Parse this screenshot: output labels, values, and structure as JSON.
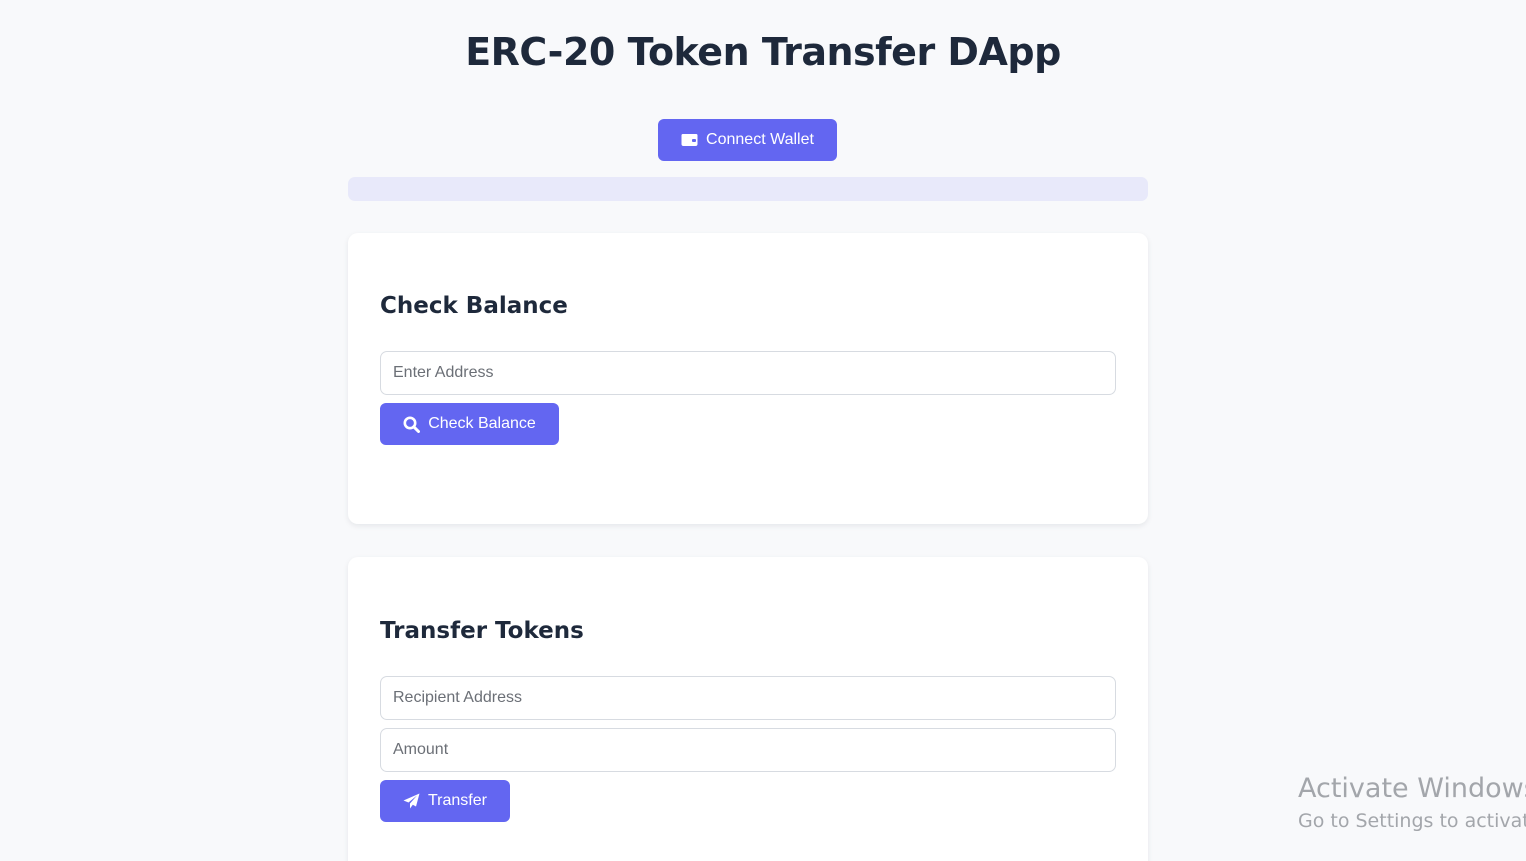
{
  "app": {
    "title": "ERC-20 Token Transfer DApp"
  },
  "header": {
    "connect_wallet_label": "Connect Wallet",
    "connect_wallet_icon": "wallet-icon",
    "status_text": ""
  },
  "check_balance": {
    "heading": "Check Balance",
    "address_input": {
      "placeholder": "Enter Address",
      "value": ""
    },
    "button_label": "Check Balance",
    "button_icon": "search-icon"
  },
  "transfer": {
    "heading": "Transfer Tokens",
    "recipient_input": {
      "placeholder": "Recipient Address",
      "value": ""
    },
    "amount_input": {
      "placeholder": "Amount",
      "value": ""
    },
    "button_label": "Transfer",
    "button_icon": "paper-plane-icon"
  },
  "os_watermark": {
    "title": "Activate Windows",
    "subtitle": "Go to Settings to activate Windows."
  },
  "colors": {
    "accent": "#6366f1",
    "page_background": "#f8f9fb",
    "status_bar": "#e8e9fa",
    "heading_text": "#1e293b"
  }
}
